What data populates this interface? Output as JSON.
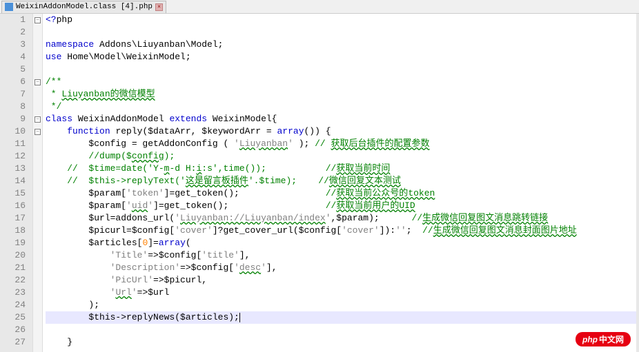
{
  "tab": {
    "filename": "WeixinAddonModel.class [4].php",
    "close": "×"
  },
  "lines": [
    {
      "n": "1",
      "fold": "-",
      "segs": [
        {
          "t": "<?",
          "c": "kw"
        },
        {
          "t": "php",
          "c": "black"
        }
      ]
    },
    {
      "n": "2",
      "fold": "",
      "segs": []
    },
    {
      "n": "3",
      "fold": "",
      "segs": [
        {
          "t": "namespace",
          "c": "kw"
        },
        {
          "t": " Addons\\Liuyanban\\Model;",
          "c": "black"
        }
      ]
    },
    {
      "n": "4",
      "fold": "",
      "segs": [
        {
          "t": "use",
          "c": "kw"
        },
        {
          "t": " Home\\Model\\WeixinModel;",
          "c": "black"
        }
      ]
    },
    {
      "n": "5",
      "fold": "",
      "segs": []
    },
    {
      "n": "6",
      "fold": "-",
      "segs": [
        {
          "t": "/**",
          "c": "cmt"
        }
      ]
    },
    {
      "n": "7",
      "fold": "",
      "segs": [
        {
          "t": " * ",
          "c": "cmt"
        },
        {
          "t": "Liuyanban的微信模型",
          "c": "cmt underline-green"
        }
      ]
    },
    {
      "n": "8",
      "fold": "",
      "segs": [
        {
          "t": " */",
          "c": "cmt"
        }
      ]
    },
    {
      "n": "9",
      "fold": "-",
      "segs": [
        {
          "t": "class",
          "c": "kw"
        },
        {
          "t": " WeixinAddonModel ",
          "c": "black"
        },
        {
          "t": "extends",
          "c": "kw"
        },
        {
          "t": " WeixinModel{",
          "c": "black"
        }
      ]
    },
    {
      "n": "10",
      "fold": "-",
      "segs": [
        {
          "t": "    ",
          "c": ""
        },
        {
          "t": "function",
          "c": "kw"
        },
        {
          "t": " reply($dataArr, $keywordArr = ",
          "c": "black"
        },
        {
          "t": "array",
          "c": "kw"
        },
        {
          "t": "()) {",
          "c": "black"
        }
      ]
    },
    {
      "n": "11",
      "fold": "",
      "segs": [
        {
          "t": "        $config = getAddonConfig ( ",
          "c": "black"
        },
        {
          "t": "'",
          "c": "str"
        },
        {
          "t": "Liuyanban",
          "c": "str underline-green"
        },
        {
          "t": "'",
          "c": "str"
        },
        {
          "t": " ); ",
          "c": "black"
        },
        {
          "t": "// ",
          "c": "cmt"
        },
        {
          "t": "获取后台插件的配置参数",
          "c": "cmt underline-green"
        }
      ]
    },
    {
      "n": "12",
      "fold": "",
      "segs": [
        {
          "t": "        ",
          "c": ""
        },
        {
          "t": "//dump($",
          "c": "cmt"
        },
        {
          "t": "config",
          "c": "cmt underline-green"
        },
        {
          "t": ");",
          "c": "cmt"
        }
      ]
    },
    {
      "n": "13",
      "fold": "",
      "segs": [
        {
          "t": "    ",
          "c": ""
        },
        {
          "t": "//  $time=date('Y-",
          "c": "cmt"
        },
        {
          "t": "m",
          "c": "cmt underline-green"
        },
        {
          "t": "-d H:",
          "c": "cmt"
        },
        {
          "t": "i",
          "c": "cmt underline-green"
        },
        {
          "t": ":s',time());           //",
          "c": "cmt"
        },
        {
          "t": "获取当前时间",
          "c": "cmt underline-green"
        }
      ]
    },
    {
      "n": "14",
      "fold": "",
      "segs": [
        {
          "t": "    ",
          "c": ""
        },
        {
          "t": "//  $this->replyText('",
          "c": "cmt"
        },
        {
          "t": "这是留言板插件",
          "c": "cmt underline-green"
        },
        {
          "t": "'.$time);    //",
          "c": "cmt"
        },
        {
          "t": "微信回复文本测试",
          "c": "cmt underline-green"
        }
      ]
    },
    {
      "n": "15",
      "fold": "",
      "segs": [
        {
          "t": "        $param[",
          "c": "black"
        },
        {
          "t": "'token'",
          "c": "str"
        },
        {
          "t": "]=get_token();                ",
          "c": "black"
        },
        {
          "t": "//",
          "c": "cmt"
        },
        {
          "t": "获取当前公众号的",
          "c": "cmt underline-green"
        },
        {
          "t": "token",
          "c": "cmt underline-green"
        }
      ]
    },
    {
      "n": "16",
      "fold": "",
      "segs": [
        {
          "t": "        $param[",
          "c": "black"
        },
        {
          "t": "'",
          "c": "str"
        },
        {
          "t": "uid",
          "c": "str underline-green"
        },
        {
          "t": "'",
          "c": "str"
        },
        {
          "t": "]=get_token();                  ",
          "c": "black"
        },
        {
          "t": "//",
          "c": "cmt"
        },
        {
          "t": "获取当前用户的UID",
          "c": "cmt underline-green"
        }
      ]
    },
    {
      "n": "17",
      "fold": "",
      "segs": [
        {
          "t": "        $url=addons_url(",
          "c": "black"
        },
        {
          "t": "'",
          "c": "str"
        },
        {
          "t": "Liuyanban://Liuyanban/index",
          "c": "str underline-green"
        },
        {
          "t": "'",
          "c": "str"
        },
        {
          "t": ",$param);      ",
          "c": "black"
        },
        {
          "t": "//",
          "c": "cmt"
        },
        {
          "t": "生成微信回复图文消息跳转链接",
          "c": "cmt underline-green"
        }
      ]
    },
    {
      "n": "18",
      "fold": "",
      "segs": [
        {
          "t": "        $picurl=$config[",
          "c": "black"
        },
        {
          "t": "'cover'",
          "c": "str"
        },
        {
          "t": "]?get_cover_url($config[",
          "c": "black"
        },
        {
          "t": "'cover'",
          "c": "str"
        },
        {
          "t": "]):",
          "c": "black"
        },
        {
          "t": "''",
          "c": "str"
        },
        {
          "t": ";  ",
          "c": "black"
        },
        {
          "t": "//",
          "c": "cmt"
        },
        {
          "t": "生成微信回复图文消息封面图片地址",
          "c": "cmt underline-green"
        }
      ]
    },
    {
      "n": "19",
      "fold": "",
      "segs": [
        {
          "t": "        $articles[",
          "c": "black"
        },
        {
          "t": "0",
          "c": "num"
        },
        {
          "t": "]=",
          "c": "black"
        },
        {
          "t": "array",
          "c": "kw"
        },
        {
          "t": "(",
          "c": "black"
        }
      ]
    },
    {
      "n": "20",
      "fold": "",
      "segs": [
        {
          "t": "            ",
          "c": ""
        },
        {
          "t": "'Title'",
          "c": "str"
        },
        {
          "t": "=>$config[",
          "c": "black"
        },
        {
          "t": "'title'",
          "c": "str"
        },
        {
          "t": "],",
          "c": "black"
        }
      ]
    },
    {
      "n": "21",
      "fold": "",
      "segs": [
        {
          "t": "            ",
          "c": ""
        },
        {
          "t": "'Description'",
          "c": "str"
        },
        {
          "t": "=>$config[",
          "c": "black"
        },
        {
          "t": "'",
          "c": "str"
        },
        {
          "t": "desc",
          "c": "str underline-green"
        },
        {
          "t": "'",
          "c": "str"
        },
        {
          "t": "],",
          "c": "black"
        }
      ]
    },
    {
      "n": "22",
      "fold": "",
      "segs": [
        {
          "t": "            ",
          "c": ""
        },
        {
          "t": "'PicUrl'",
          "c": "str"
        },
        {
          "t": "=>$picurl,",
          "c": "black"
        }
      ]
    },
    {
      "n": "23",
      "fold": "",
      "segs": [
        {
          "t": "            ",
          "c": ""
        },
        {
          "t": "'",
          "c": "str"
        },
        {
          "t": "Url",
          "c": "str underline-green"
        },
        {
          "t": "'",
          "c": "str"
        },
        {
          "t": "=>$url",
          "c": "black"
        }
      ]
    },
    {
      "n": "24",
      "fold": "",
      "segs": [
        {
          "t": "        );",
          "c": "black"
        }
      ]
    },
    {
      "n": "25",
      "fold": "",
      "hl": true,
      "segs": [
        {
          "t": "        $this->replyNews($articles);",
          "c": "black"
        },
        {
          "t": "|",
          "c": "cursor-mark"
        }
      ]
    },
    {
      "n": "26",
      "fold": "",
      "segs": []
    },
    {
      "n": "27",
      "fold": "",
      "segs": [
        {
          "t": "    }",
          "c": "black"
        }
      ]
    }
  ],
  "watermark": {
    "logo": "php",
    "text": "中文网"
  }
}
